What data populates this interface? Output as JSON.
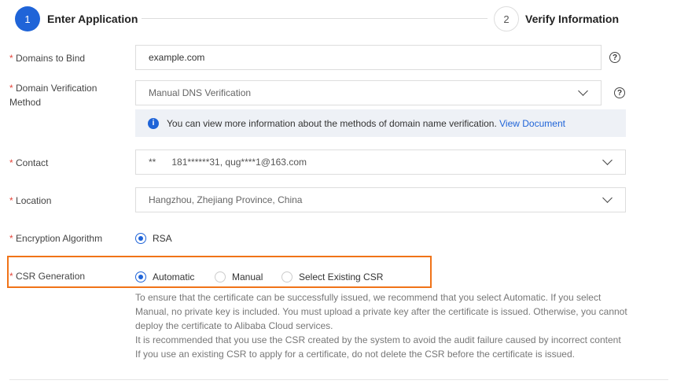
{
  "steps": [
    {
      "number": "1",
      "title": "Enter Application"
    },
    {
      "number": "2",
      "title": "Verify Information"
    }
  ],
  "form": {
    "domains": {
      "label": "Domains to Bind",
      "value": "example.com"
    },
    "verification": {
      "label_line1": "Domain Verification",
      "label_line2": "Method",
      "value": "Manual DNS Verification",
      "info": "You can view more information about the methods of domain name verification.",
      "info_link": "View Document"
    },
    "contact": {
      "label": "Contact",
      "value": "**      181******31, qug****1@163.com"
    },
    "location": {
      "label": "Location",
      "value": "Hangzhou, Zhejiang Province, China"
    },
    "encryption": {
      "label": "Encryption Algorithm",
      "option": "RSA"
    },
    "csr": {
      "label": "CSR Generation",
      "options": [
        "Automatic",
        "Manual",
        "Select Existing CSR"
      ],
      "selected": "Automatic",
      "notes": [
        "To ensure that the certificate can be successfully issued, we recommend that you select Automatic. If you select",
        "Manual, no private key is included. You must upload a private key after the certificate is issued. Otherwise, you cannot",
        "deploy the certificate to Alibaba Cloud services.",
        "It is recommended that you use the CSR created by the system to avoid the audit failure caused by incorrect content",
        "If you use an existing CSR to apply for a certificate, do not delete the CSR before the certificate is issued."
      ]
    }
  },
  "required_mark": "*",
  "help_glyph": "?",
  "colors": {
    "primary": "#1f64d8",
    "highlight": "#f07318",
    "required": "#e5463b"
  }
}
